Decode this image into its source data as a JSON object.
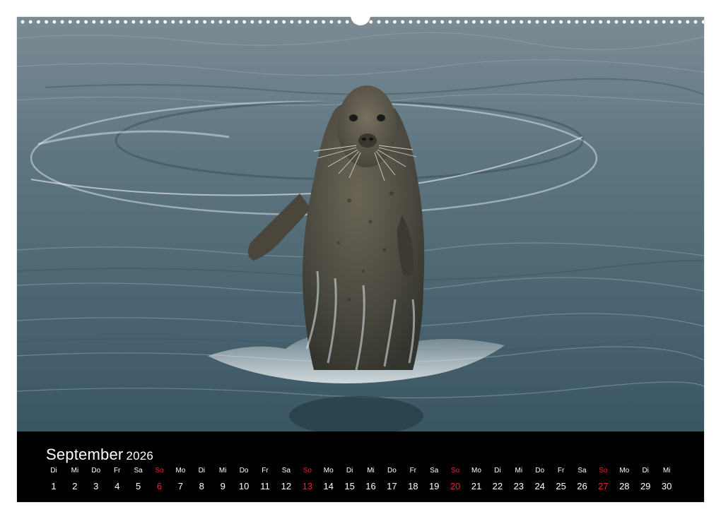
{
  "photo": {
    "subject": "harbor seal standing upright in water",
    "icon": "seal-photo"
  },
  "calendar": {
    "month": "September",
    "year": "2026",
    "accent_sunday": "#e3262a",
    "days": [
      {
        "wd": "Di",
        "n": "1"
      },
      {
        "wd": "Mi",
        "n": "2"
      },
      {
        "wd": "Do",
        "n": "3"
      },
      {
        "wd": "Fr",
        "n": "4"
      },
      {
        "wd": "Sa",
        "n": "5"
      },
      {
        "wd": "So",
        "n": "6",
        "sun": true
      },
      {
        "wd": "Mo",
        "n": "7"
      },
      {
        "wd": "Di",
        "n": "8"
      },
      {
        "wd": "Mi",
        "n": "9"
      },
      {
        "wd": "Do",
        "n": "10"
      },
      {
        "wd": "Fr",
        "n": "11"
      },
      {
        "wd": "Sa",
        "n": "12"
      },
      {
        "wd": "So",
        "n": "13",
        "sun": true
      },
      {
        "wd": "Mo",
        "n": "14"
      },
      {
        "wd": "Di",
        "n": "15"
      },
      {
        "wd": "Mi",
        "n": "16"
      },
      {
        "wd": "Do",
        "n": "17"
      },
      {
        "wd": "Fr",
        "n": "18"
      },
      {
        "wd": "Sa",
        "n": "19"
      },
      {
        "wd": "So",
        "n": "20",
        "sun": true
      },
      {
        "wd": "Mo",
        "n": "21"
      },
      {
        "wd": "Di",
        "n": "22"
      },
      {
        "wd": "Mi",
        "n": "23"
      },
      {
        "wd": "Do",
        "n": "24"
      },
      {
        "wd": "Fr",
        "n": "25"
      },
      {
        "wd": "Sa",
        "n": "26"
      },
      {
        "wd": "So",
        "n": "27",
        "sun": true
      },
      {
        "wd": "Mo",
        "n": "28"
      },
      {
        "wd": "Di",
        "n": "29"
      },
      {
        "wd": "Mi",
        "n": "30"
      }
    ]
  }
}
